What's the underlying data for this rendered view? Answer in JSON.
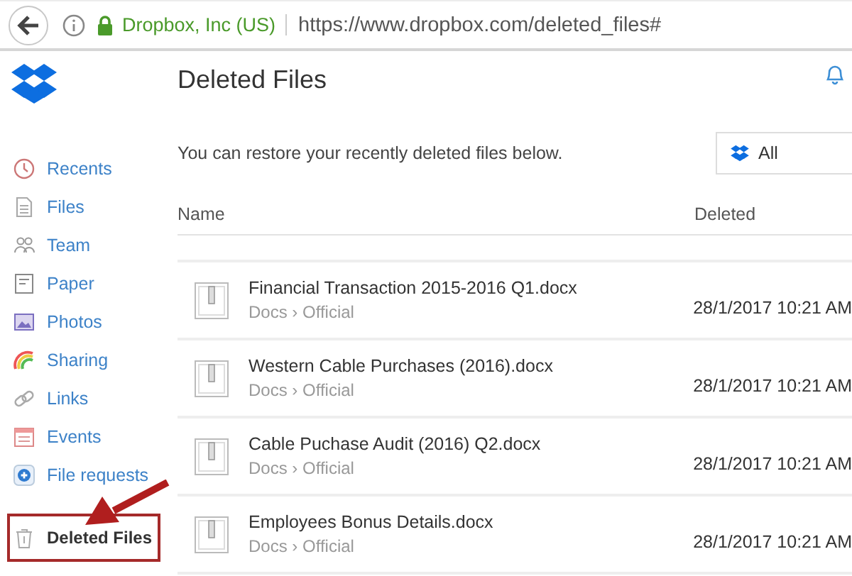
{
  "browser": {
    "site_identity": "Dropbox, Inc (US)",
    "url": "https://www.dropbox.com/deleted_files#"
  },
  "sidebar": {
    "items": [
      {
        "label": "Recents",
        "selected": false,
        "highlighted": false
      },
      {
        "label": "Files",
        "selected": false,
        "highlighted": false
      },
      {
        "label": "Team",
        "selected": false,
        "highlighted": false
      },
      {
        "label": "Paper",
        "selected": false,
        "highlighted": false
      },
      {
        "label": "Photos",
        "selected": false,
        "highlighted": false
      },
      {
        "label": "Sharing",
        "selected": false,
        "highlighted": false
      },
      {
        "label": "Links",
        "selected": false,
        "highlighted": false
      },
      {
        "label": "Events",
        "selected": false,
        "highlighted": false
      },
      {
        "label": "File requests",
        "selected": false,
        "highlighted": false
      },
      {
        "label": "Deleted Files",
        "selected": true,
        "highlighted": true
      }
    ]
  },
  "page": {
    "title": "Deleted Files",
    "subtitle": "You can restore your recently deleted files below.",
    "filter": {
      "value": "All"
    }
  },
  "table": {
    "columns": [
      "Name",
      "Deleted"
    ],
    "rows": [
      {
        "name": "Financial Transaction 2015-2016 Q1.docx",
        "path": "Docs › Official",
        "deleted": "28/1/2017 10:21 AM"
      },
      {
        "name": "Western Cable Purchases (2016).docx",
        "path": "Docs › Official",
        "deleted": "28/1/2017 10:21 AM"
      },
      {
        "name": "Cable Puchase Audit (2016) Q2.docx",
        "path": "Docs › Official",
        "deleted": "28/1/2017 10:21 AM"
      },
      {
        "name": "Employees Bonus Details.docx",
        "path": "Docs › Official",
        "deleted": "28/1/2017 10:21 AM"
      }
    ]
  },
  "annotation_arrow": true
}
